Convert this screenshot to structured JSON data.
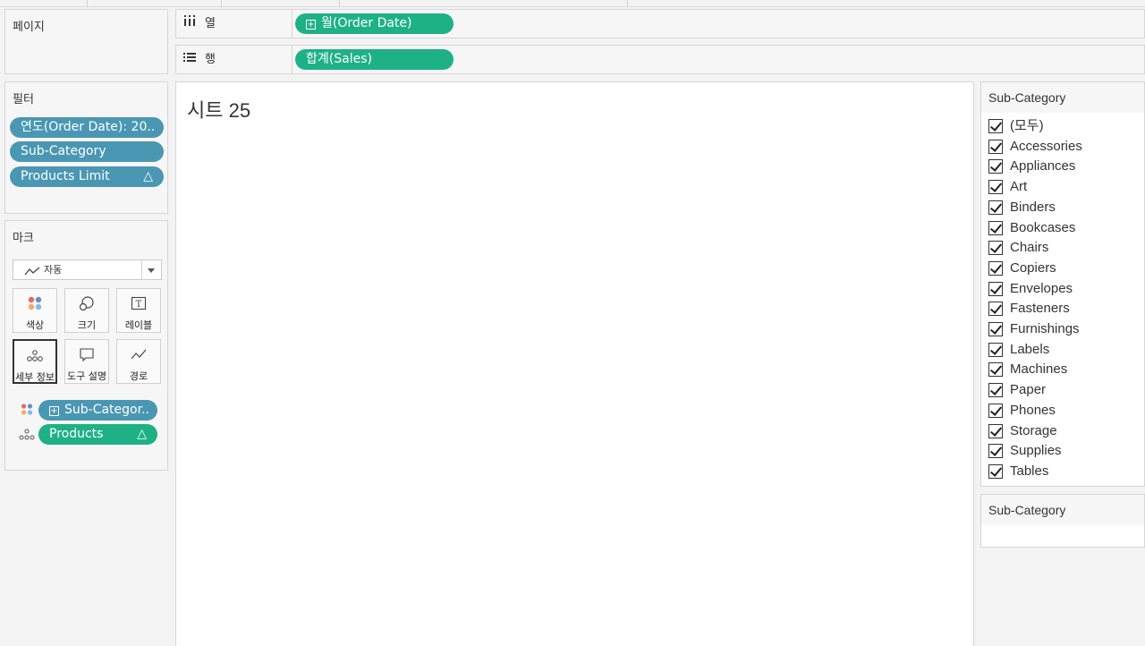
{
  "pages": {
    "title": "페이지"
  },
  "filters": {
    "title": "필터",
    "items": [
      {
        "label": "연도(Order Date): 20.."
      },
      {
        "label": "Sub-Category"
      },
      {
        "label": "Products Limit",
        "delta": "△"
      }
    ]
  },
  "marks": {
    "title": "마크",
    "type_select": "자동",
    "buttons": [
      {
        "label": "색상"
      },
      {
        "label": "크기"
      },
      {
        "label": "레이블"
      },
      {
        "label": "세부 정보"
      },
      {
        "label": "도구 설명"
      },
      {
        "label": "경로"
      }
    ],
    "fields": [
      {
        "label": "Sub-Categor..",
        "plus": "+"
      },
      {
        "label": "Products",
        "delta": "△"
      }
    ]
  },
  "shelves": {
    "columns": {
      "label": "열",
      "pill": "월(Order Date)",
      "plus": "+"
    },
    "rows": {
      "label": "행",
      "pill": "합계(Sales)"
    }
  },
  "sheet": {
    "title": "시트 25"
  },
  "subcategory_filter": {
    "title": "Sub-Category",
    "items": [
      "(모두)",
      "Accessories",
      "Appliances",
      "Art",
      "Binders",
      "Bookcases",
      "Chairs",
      "Copiers",
      "Envelopes",
      "Fasteners",
      "Furnishings",
      "Labels",
      "Machines",
      "Paper",
      "Phones",
      "Storage",
      "Supplies",
      "Tables"
    ]
  },
  "subcategory_card2": {
    "title": "Sub-Category"
  },
  "colors": {
    "blue_pill": "#4a97b3",
    "green_pill": "#1fb186"
  }
}
